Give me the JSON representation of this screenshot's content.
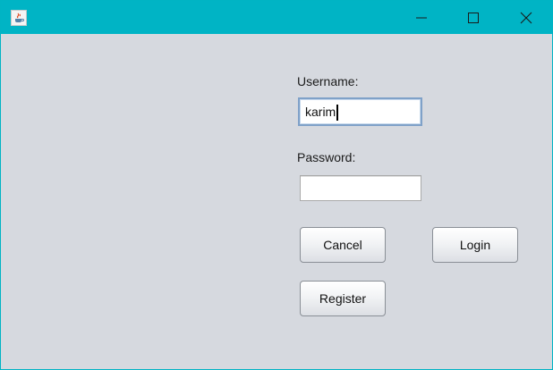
{
  "window": {
    "app_icon": "java-coffee-icon",
    "controls": {
      "minimize_icon": "minimize-icon",
      "maximize_icon": "maximize-icon",
      "close_icon": "close-icon"
    },
    "accent_color": "#00b4c5",
    "background_color": "#d6d9df"
  },
  "form": {
    "username_label": "Username:",
    "username_value": "karim",
    "password_label": "Password:",
    "password_value": "",
    "cancel_label": "Cancel",
    "login_label": "Login",
    "register_label": "Register"
  }
}
